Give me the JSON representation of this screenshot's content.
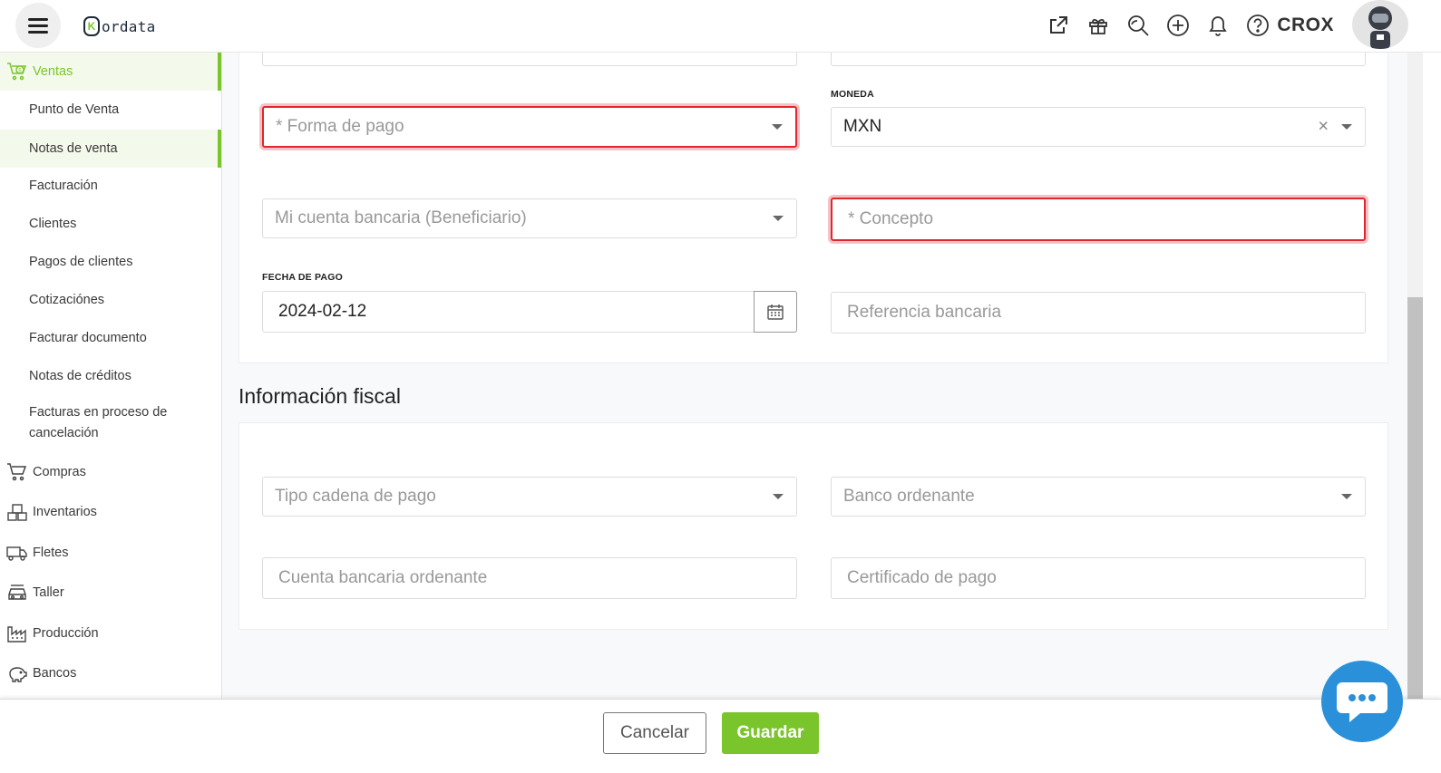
{
  "header": {
    "logo_mark": "K",
    "logo_text": "ordata",
    "icons": [
      "external-link-icon",
      "gift-icon",
      "search-zoom-icon",
      "plus-circle-icon",
      "bell-icon",
      "help-icon"
    ],
    "username": "CROX"
  },
  "sidebar": {
    "ventas_label": "Ventas",
    "sub_items": [
      "Punto de Venta",
      "Notas de venta",
      "Facturación",
      "Clientes",
      "Pagos de clientes",
      "Cotizaciónes",
      "Facturar documento",
      "Notas de créditos",
      "Facturas en proceso de cancelación"
    ],
    "modules": [
      "Compras",
      "Inventarios",
      "Fletes",
      "Taller",
      "Producción",
      "Bancos"
    ]
  },
  "payment_form": {
    "forma_de_pago_placeholder": "* Forma de pago",
    "moneda_label": "MONEDA",
    "moneda_value": "MXN",
    "cuenta_beneficiario_placeholder": "Mi cuenta bancaria (Beneficiario)",
    "concepto_placeholder": "* Concepto",
    "fecha_label": "FECHA DE PAGO",
    "fecha_value": "2024-02-12",
    "referencia_placeholder": "Referencia bancaria"
  },
  "fiscal": {
    "title": "Información fiscal",
    "tipo_cadena_placeholder": "Tipo cadena de pago",
    "banco_ordenante_placeholder": "Banco ordenante",
    "cuenta_ordenante_placeholder": "Cuenta bancaria ordenante",
    "certificado_placeholder": "Certificado de pago"
  },
  "footer": {
    "cancel_label": "Cancelar",
    "save_label": "Guardar"
  },
  "colors": {
    "accent": "#7ac52b",
    "error": "#e0262e",
    "chat": "#2a90d9"
  }
}
